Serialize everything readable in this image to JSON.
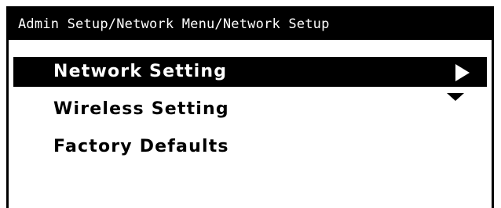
{
  "panel": {
    "breadcrumb": "Admin Setup/Network Menu/Network Setup"
  },
  "menu": {
    "items": [
      {
        "label": "Network Setting",
        "selected": true
      },
      {
        "label": "Wireless Setting",
        "selected": false
      },
      {
        "label": "Factory Defaults",
        "selected": false
      }
    ]
  },
  "icons": {
    "enter_submenu": "triangle-right-icon",
    "scroll_more": "triangle-down-icon"
  }
}
